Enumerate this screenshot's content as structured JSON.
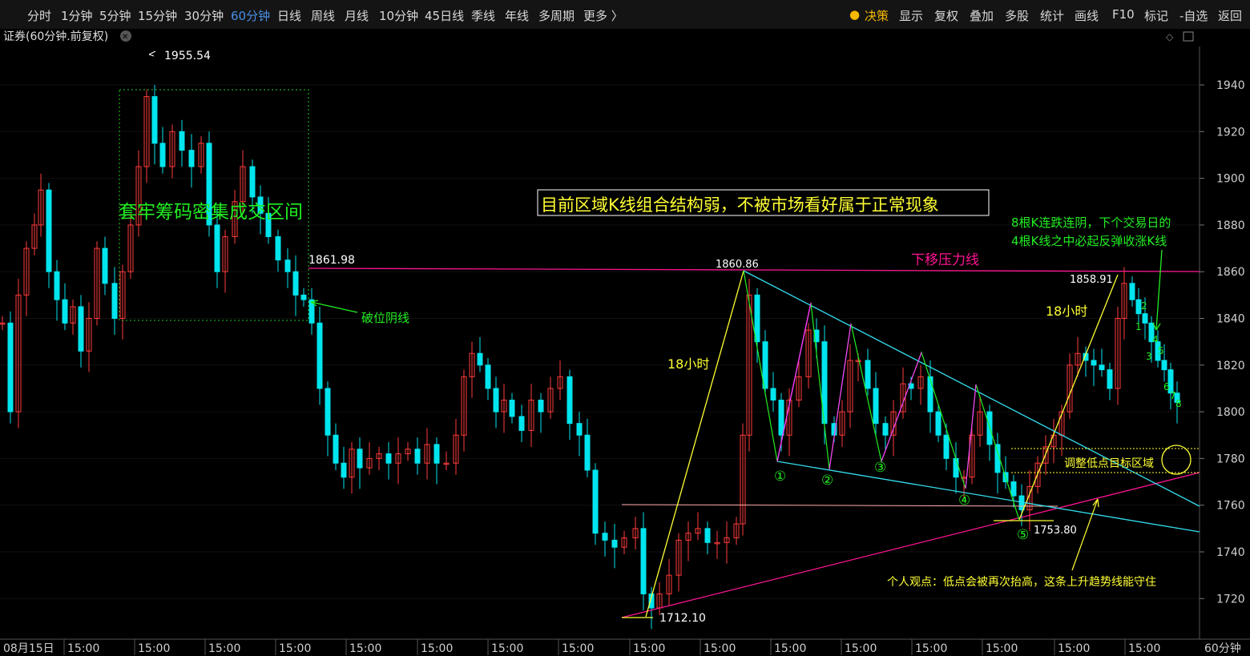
{
  "toolbar": {
    "intervals": [
      "分时",
      "1分钟",
      "5分钟",
      "15分钟",
      "30分钟",
      "60分钟",
      "日线",
      "周线",
      "月线",
      "10分钟",
      "45日线",
      "季线",
      "年线",
      "多周期",
      "更多 〉"
    ],
    "active_interval": "60分钟",
    "tools": [
      "决策",
      "显示",
      "复权",
      "叠加",
      "多股",
      "统计",
      "画线",
      "F10",
      "标记",
      "-自选",
      "返回"
    ]
  },
  "chart": {
    "title": "证券(60分钟.前复权)",
    "price_axis_labels": [
      "1940",
      "1920",
      "1900",
      "1880",
      "1860",
      "1840",
      "1820",
      "1800",
      "1780",
      "1760",
      "1740",
      "1720"
    ],
    "time_axis_labels": [
      "08月15日",
      "15:00",
      "15:00",
      "15:00",
      "15:00",
      "15:00",
      "15:00",
      "15:00",
      "15:00",
      "15:00",
      "15:00",
      "15:00",
      "15:00",
      "15:00",
      "15:00",
      "15:00",
      "15:00"
    ],
    "period_label": "60分钟",
    "colors": {
      "up": "#ff3b3b",
      "down": "#00e5ee",
      "green": "#22ee22",
      "yellow": "#ffff33",
      "magenta": "#ff1493",
      "cyan": "#33ddee",
      "pink": "#ff33ff",
      "background": "#000000"
    },
    "annotations": {
      "price_high": "1955.54",
      "price_breakdown": "1861.98",
      "price_peak": "1860.86",
      "price_peak2": "1858.91",
      "price_low": "1712.10",
      "price_low2": "1753.80",
      "zone_label": "套牢筹码密集成交区间",
      "breakdown_label": "破位阴线",
      "headline": "目前区域K线组合结构弱，不被市场看好属于正常现象",
      "resistance_label": "下移压力线",
      "hours_label_1": "18小时",
      "hours_label_2": "18小时",
      "rebound_note_1": "8根K连跌连阴，下个交易日的",
      "rebound_note_2": "4根K线之中必起反弹收涨K线",
      "target_zone_label": "调整低点目标区域",
      "opinion": "个人观点：低点会被再次抬高，这条上升趋势线能守住",
      "wave_marks": [
        "①",
        "②",
        "③",
        "④",
        "⑤"
      ],
      "count_marks": [
        "1",
        "2",
        "3",
        "4",
        "5",
        "6",
        "7",
        "8"
      ]
    }
  }
}
